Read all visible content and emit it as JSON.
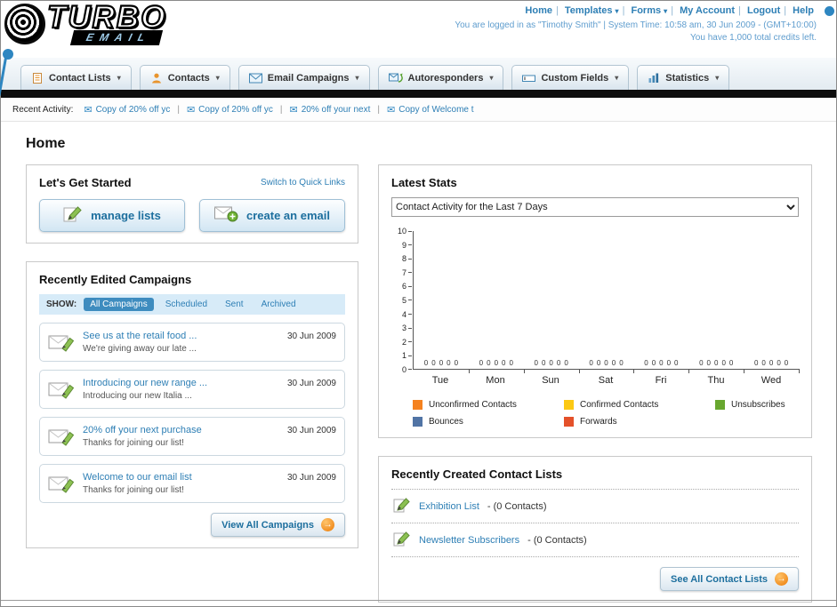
{
  "header": {
    "logo_main": "TURBO",
    "logo_sub": "EMAIL",
    "links": [
      {
        "label": "Home",
        "dropdown": false
      },
      {
        "label": "Templates",
        "dropdown": true
      },
      {
        "label": "Forms",
        "dropdown": true
      },
      {
        "label": "My Account",
        "dropdown": false
      },
      {
        "label": "Logout",
        "dropdown": false
      },
      {
        "label": "Help",
        "dropdown": false
      }
    ],
    "login_info": "You are logged in as \"Timothy Smith\" | System Time: 10:58 am, 30 Jun 2009 - (GMT+10:00)",
    "credits_info": "You have 1,000 total credits left."
  },
  "nav_tabs": [
    {
      "label": "Contact Lists",
      "icon": "contact-lists-icon"
    },
    {
      "label": "Contacts",
      "icon": "contacts-icon"
    },
    {
      "label": "Email Campaigns",
      "icon": "email-campaigns-icon"
    },
    {
      "label": "Autoresponders",
      "icon": "autoresponders-icon"
    },
    {
      "label": "Custom Fields",
      "icon": "custom-fields-icon"
    },
    {
      "label": "Statistics",
      "icon": "statistics-icon"
    }
  ],
  "recent_activity": {
    "label": "Recent Activity:",
    "items": [
      "Copy of 20% off yc",
      "Copy of 20% off yc",
      "20% off your next",
      "Copy of Welcome t"
    ]
  },
  "page": {
    "title": "Home"
  },
  "get_started": {
    "title": "Let's Get Started",
    "switch_link": "Switch to Quick Links",
    "buttons": [
      {
        "label": "manage lists",
        "icon": "pencil-icon"
      },
      {
        "label": "create an email",
        "icon": "envelope-plus-icon"
      }
    ]
  },
  "campaigns": {
    "title": "Recently Edited Campaigns",
    "show_label": "SHOW:",
    "filters": [
      "All Campaigns",
      "Scheduled",
      "Sent",
      "Archived"
    ],
    "active_filter": "All Campaigns",
    "items": [
      {
        "title": "See us at the retail food ...",
        "subtitle": "We're giving away our late ...",
        "date": "30 Jun 2009"
      },
      {
        "title": "Introducing our new range ...",
        "subtitle": "Introducing our new Italia ...",
        "date": "30 Jun 2009"
      },
      {
        "title": "20% off your next purchase",
        "subtitle": "Thanks for joining our list!",
        "date": "30 Jun 2009"
      },
      {
        "title": "Welcome to our email list",
        "subtitle": "Thanks for joining our list!",
        "date": "30 Jun 2009"
      }
    ],
    "view_all_label": "View All Campaigns"
  },
  "stats": {
    "title": "Latest Stats",
    "dropdown_value": "Contact Activity for the Last 7 Days"
  },
  "chart_data": {
    "type": "bar",
    "title": "Contact Activity for the Last 7 Days",
    "categories": [
      "Tue",
      "Mon",
      "Sun",
      "Sat",
      "Fri",
      "Thu",
      "Wed"
    ],
    "series": [
      {
        "name": "Unconfirmed Contacts",
        "color": "#f5821f",
        "values": [
          0,
          0,
          0,
          0,
          0,
          0,
          0
        ]
      },
      {
        "name": "Confirmed Contacts",
        "color": "#fcc913",
        "values": [
          0,
          0,
          0,
          0,
          0,
          0,
          0
        ]
      },
      {
        "name": "Unsubscribes",
        "color": "#68a72f",
        "values": [
          0,
          0,
          0,
          0,
          0,
          0,
          0
        ]
      },
      {
        "name": "Bounces",
        "color": "#5174a5",
        "values": [
          0,
          0,
          0,
          0,
          0,
          0,
          0
        ]
      },
      {
        "name": "Forwards",
        "color": "#e4512a",
        "values": [
          0,
          0,
          0,
          0,
          0,
          0,
          0
        ]
      }
    ],
    "ylim": [
      0,
      10
    ],
    "ytick_step": 1,
    "legend_position": "bottom",
    "grid": false,
    "value_labels": true
  },
  "contact_lists": {
    "title": "Recently Created Contact Lists",
    "items": [
      {
        "name": "Exhibition List",
        "count": "(0 Contacts)"
      },
      {
        "name": "Newsletter Subscribers",
        "count": "(0 Contacts)"
      }
    ],
    "see_all_label": "See All Contact Lists"
  }
}
